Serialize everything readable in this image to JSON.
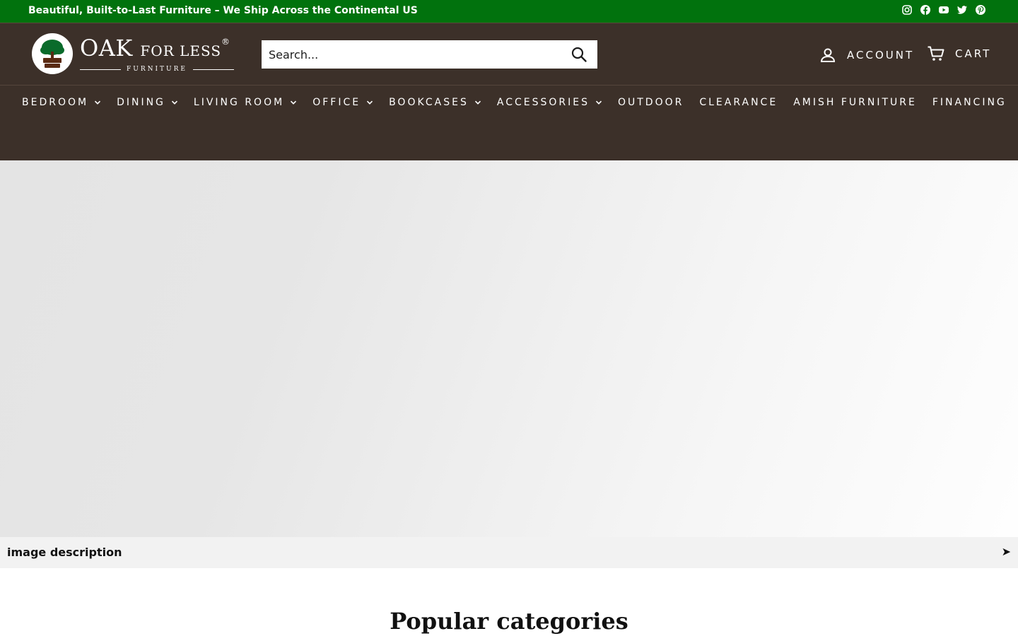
{
  "announcement": {
    "text": "Beautiful, Built-to-Last Furniture – We Ship Across the Continental US",
    "social": [
      "instagram-icon",
      "facebook-icon",
      "youtube-icon",
      "twitter-icon",
      "pinterest-icon"
    ]
  },
  "logo": {
    "emblem_text": "Oak FOR LESS",
    "name_main": "OAK",
    "name_small": "FOR LESS",
    "registered": "®",
    "subtitle": "FURNITURE"
  },
  "search": {
    "placeholder": "Search..."
  },
  "header": {
    "account_label": "ACCOUNT",
    "cart_label": "CART"
  },
  "nav": {
    "items": [
      {
        "label": "BEDROOM",
        "dropdown": true
      },
      {
        "label": "DINING",
        "dropdown": true
      },
      {
        "label": "LIVING ROOM",
        "dropdown": true
      },
      {
        "label": "OFFICE",
        "dropdown": true
      },
      {
        "label": "BOOKCASES",
        "dropdown": true
      },
      {
        "label": "ACCESSORIES",
        "dropdown": true
      },
      {
        "label": "OUTDOOR",
        "dropdown": false
      },
      {
        "label": "CLEARANCE",
        "dropdown": false
      },
      {
        "label": "AMISH FURNITURE",
        "dropdown": false
      },
      {
        "label": "FINANCING",
        "dropdown": false
      }
    ]
  },
  "hero": {
    "description_label": "image description",
    "arrow": "➤"
  },
  "sections": {
    "popular_title": "Popular categories"
  },
  "colors": {
    "announcement_bg": "#01720d",
    "header_bg": "#3c3029",
    "emblem_green": "#0a6b2b",
    "emblem_brown": "#5a2a12"
  }
}
